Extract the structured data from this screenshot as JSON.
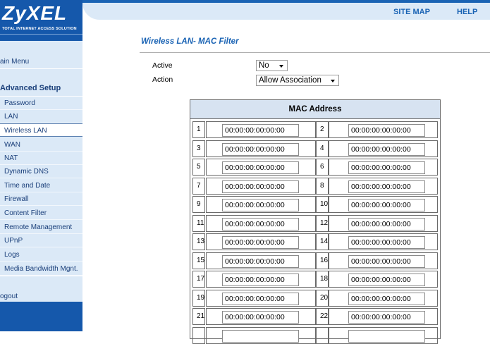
{
  "brand": {
    "name": "ZyXEL",
    "tagline": "TOTAL INTERNET ACCESS SOLUTION"
  },
  "top_nav": {
    "site_map": "SITE MAP",
    "help": "HELP"
  },
  "sidebar": {
    "main_menu": "ain Menu",
    "advanced_setup": "Advanced Setup",
    "items": [
      "Password",
      "LAN",
      "Wireless LAN",
      "WAN",
      "NAT",
      "Dynamic DNS",
      "Time and Date",
      "Firewall",
      "Content Filter",
      "Remote Management",
      "UPnP",
      "Logs",
      "Media Bandwidth Mgnt."
    ],
    "active": "Wireless LAN",
    "logout": "ogout"
  },
  "page": {
    "title": "Wireless LAN- MAC Filter",
    "active_label": "Active",
    "active_value": "No",
    "action_label": "Action",
    "action_value": "Allow Association"
  },
  "mac_table": {
    "header": "MAC Address",
    "rows": [
      {
        "left_num": "1",
        "left_mac": "00:00:00:00:00:00",
        "right_num": "2",
        "right_mac": "00:00:00:00:00:00"
      },
      {
        "left_num": "3",
        "left_mac": "00:00:00:00:00:00",
        "right_num": "4",
        "right_mac": "00:00:00:00:00:00"
      },
      {
        "left_num": "5",
        "left_mac": "00:00:00:00:00:00",
        "right_num": "6",
        "right_mac": "00:00:00:00:00:00"
      },
      {
        "left_num": "7",
        "left_mac": "00:00:00:00:00:00",
        "right_num": "8",
        "right_mac": "00:00:00:00:00:00"
      },
      {
        "left_num": "9",
        "left_mac": "00:00:00:00:00:00",
        "right_num": "10",
        "right_mac": "00:00:00:00:00:00"
      },
      {
        "left_num": "11",
        "left_mac": "00:00:00:00:00:00",
        "right_num": "12",
        "right_mac": "00:00:00:00:00:00"
      },
      {
        "left_num": "13",
        "left_mac": "00:00:00:00:00:00",
        "right_num": "14",
        "right_mac": "00:00:00:00:00:00"
      },
      {
        "left_num": "15",
        "left_mac": "00:00:00:00:00:00",
        "right_num": "16",
        "right_mac": "00:00:00:00:00:00"
      },
      {
        "left_num": "17",
        "left_mac": "00:00:00:00:00:00",
        "right_num": "18",
        "right_mac": "00:00:00:00:00:00"
      },
      {
        "left_num": "19",
        "left_mac": "00:00:00:00:00:00",
        "right_num": "20",
        "right_mac": "00:00:00:00:00:00"
      },
      {
        "left_num": "21",
        "left_mac": "00:00:00:00:00:00",
        "right_num": "22",
        "right_mac": "00:00:00:00:00:00"
      },
      {
        "left_num": "",
        "left_mac": "",
        "right_num": "",
        "right_mac": ""
      }
    ]
  },
  "colors": {
    "brand_blue": "#1558ab",
    "sidebar_bg": "#dbe9f7",
    "link_blue": "#1a63b4",
    "table_header_bg": "#d7e3f1"
  }
}
